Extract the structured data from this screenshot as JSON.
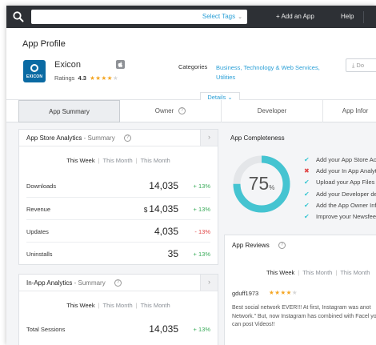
{
  "topbar": {
    "search_placeholder": "",
    "tags_select": "Select Tags",
    "add_app": "+ Add an App",
    "help": "Help"
  },
  "header": {
    "page_title": "App Profile",
    "app_name": "Exicon",
    "logo_text": "EXICON",
    "ratings_label": "Ratings",
    "rating_value": "4.3",
    "rating_stars": 4.3,
    "categories_label": "Categories",
    "categories_value": "Business, Technology & Web Services, Utilities",
    "download_label": "Do",
    "details_label": "Details"
  },
  "tabs": [
    {
      "label": "App Summary",
      "active": true,
      "info": false
    },
    {
      "label": "Owner",
      "active": false,
      "info": true
    },
    {
      "label": "Developer",
      "active": false,
      "info": false
    },
    {
      "label": "App Infor",
      "active": false,
      "info": false
    }
  ],
  "store_analytics": {
    "title": "App Store Analytics",
    "subtitle": "- Summary",
    "periods": [
      "This Week",
      "This Month",
      "This Month"
    ],
    "rows": [
      {
        "label": "Downloads",
        "currency": "",
        "value": "14,035",
        "change": "+ 13%",
        "trend": "pos"
      },
      {
        "label": "Revenue",
        "currency": "$",
        "value": "14,035",
        "change": "+ 13%",
        "trend": "pos"
      },
      {
        "label": "Updates",
        "currency": "",
        "value": "4,035",
        "change": "- 13%",
        "trend": "neg"
      },
      {
        "label": "Uninstalls",
        "currency": "",
        "value": "35",
        "change": "+ 13%",
        "trend": "pos"
      }
    ]
  },
  "inapp_analytics": {
    "title": "In-App Analytics",
    "subtitle": "- Summary",
    "periods": [
      "This Week",
      "This Month",
      "This Month"
    ],
    "rows": [
      {
        "label": "Total Sessions",
        "currency": "",
        "value": "14,035",
        "change": "+ 13%",
        "trend": "pos"
      }
    ]
  },
  "completeness": {
    "title": "App Completeness",
    "percent": 75,
    "percent_number": "75",
    "percent_sign": "%",
    "ring_color": "#45c4d1",
    "items": [
      {
        "label": "Add your App Store Ac",
        "done": true
      },
      {
        "label": "Add your In App Analyt",
        "done": false
      },
      {
        "label": "Upload your App Files",
        "done": true
      },
      {
        "label": "Add your Developer de",
        "done": true
      },
      {
        "label": "Add the App Owner Info",
        "done": true
      },
      {
        "label": "Improve your Newsfee",
        "done": true
      }
    ]
  },
  "reviews": {
    "title": "App Reviews",
    "periods": [
      "This Week",
      "This Month",
      "This Month"
    ],
    "user": "gduff1973",
    "stars": 4,
    "text": "Best social network EVER!!! At first, Instagram was anot Network.\" But, now Instagram has combined with Facel you can post Videos!!"
  },
  "colors": {
    "topbar": "#2d3035",
    "accent": "#2a9fd6",
    "positive": "#3aab5a",
    "negative": "#e04646",
    "star": "#f5a623"
  }
}
